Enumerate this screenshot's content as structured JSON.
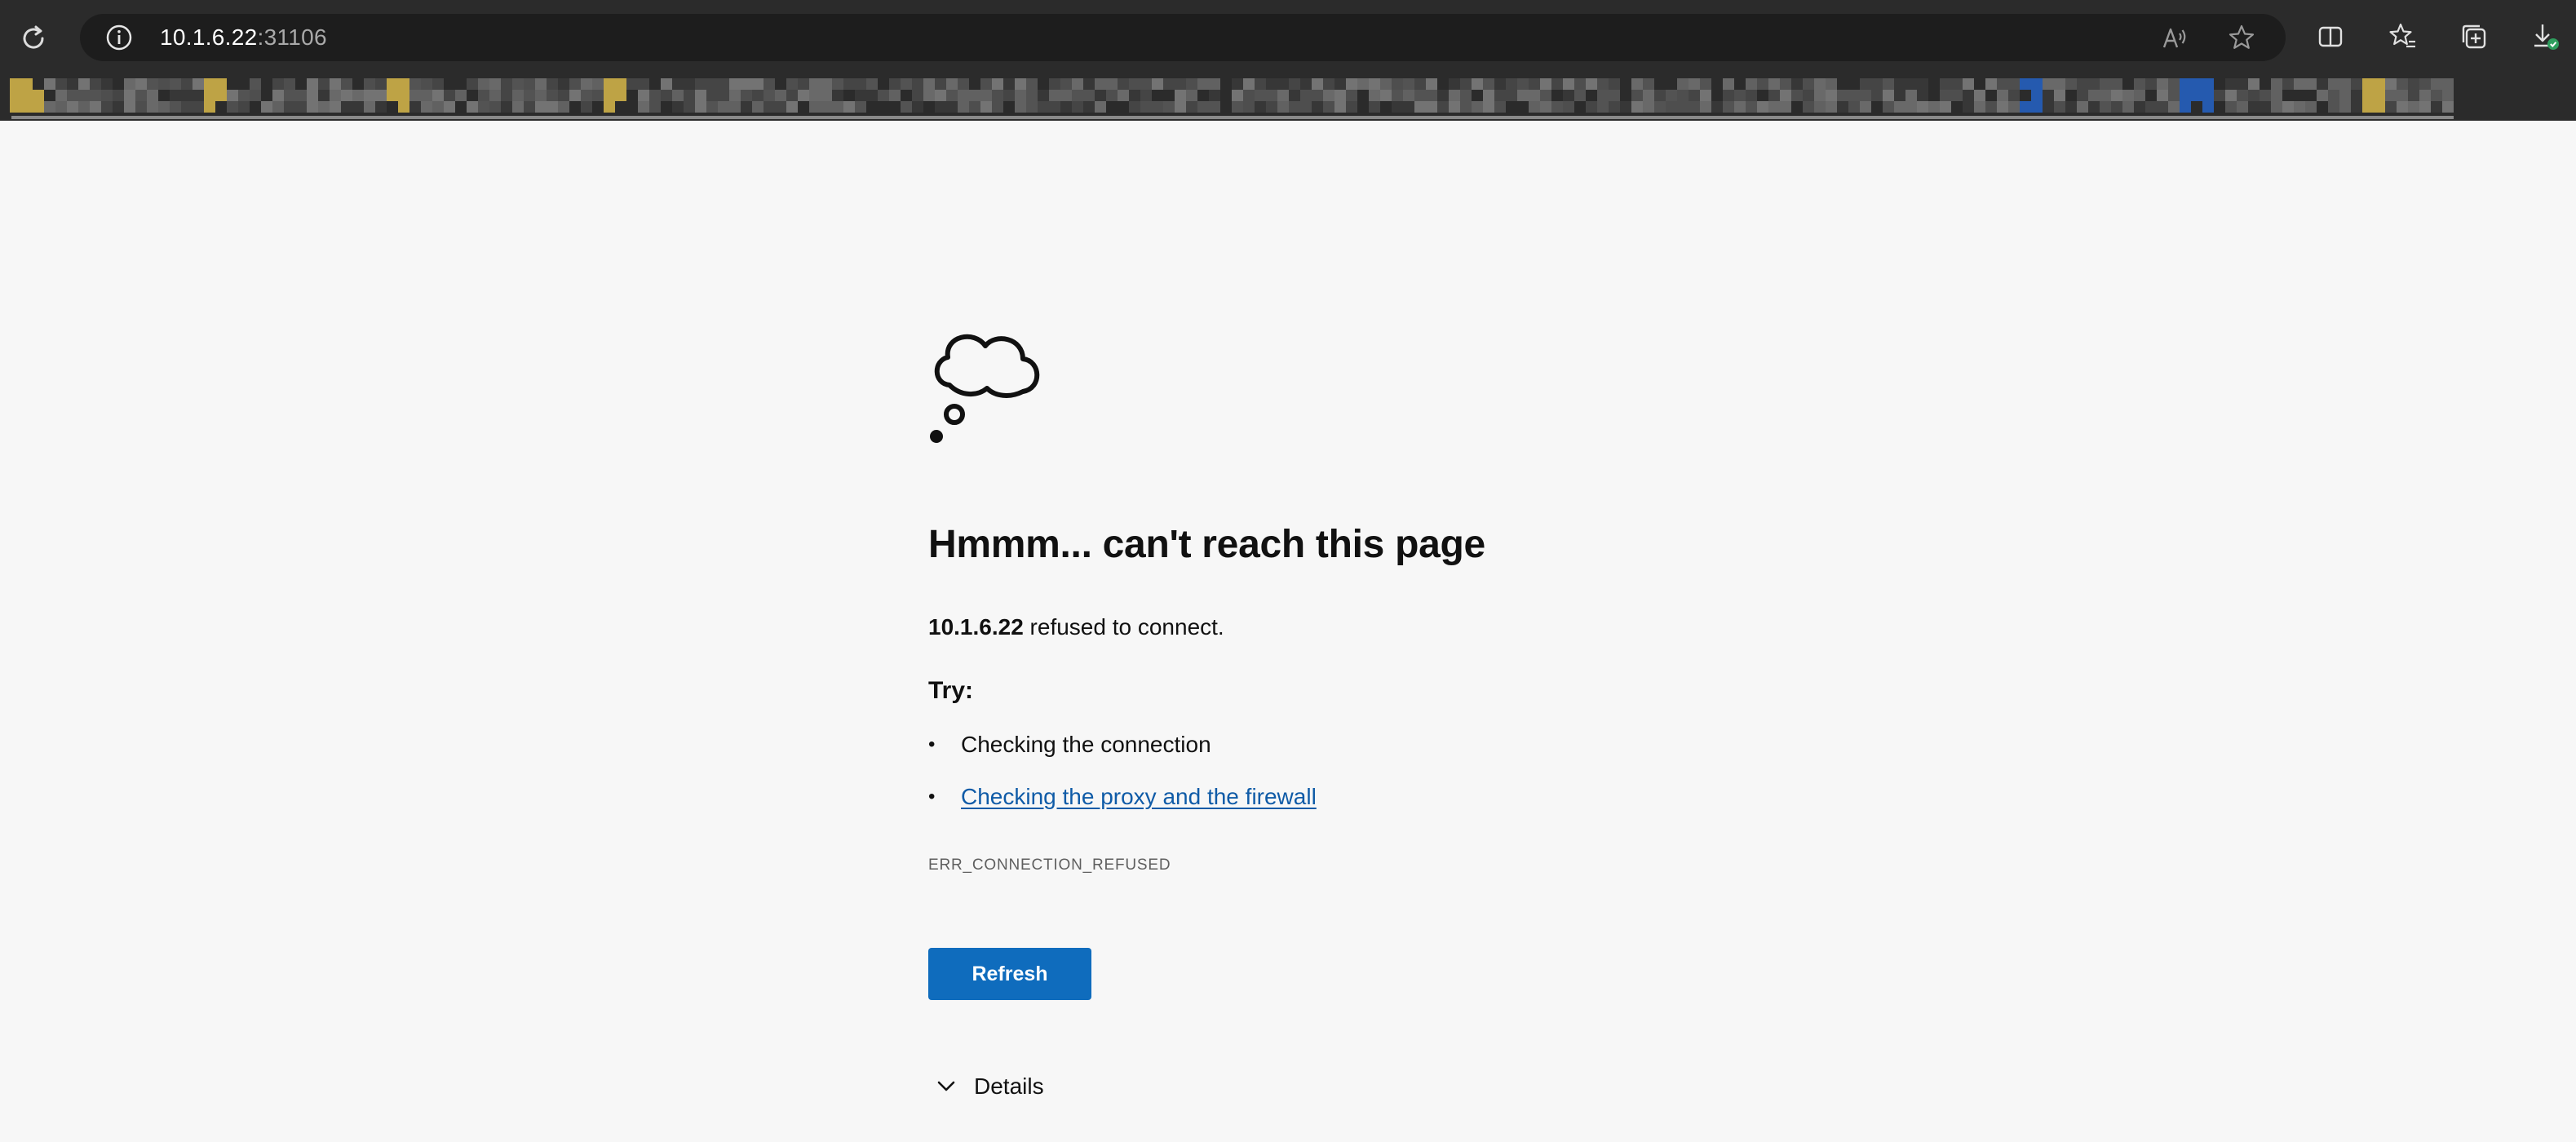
{
  "browser": {
    "url_host": "10.1.6.22",
    "url_port": ":31106",
    "icons": {
      "reload": "reload-icon",
      "site_info": "info-icon",
      "read_aloud": "read-aloud-icon",
      "favorite": "star-icon",
      "split_screen": "split-screen-icon",
      "favorites": "favorites-icon",
      "collections": "collections-icon",
      "downloads": "download-icon"
    }
  },
  "page": {
    "heading": "Hmmm... can't reach this page",
    "message_host": "10.1.6.22",
    "message_rest": " refused to connect.",
    "try_label": "Try:",
    "suggestions": [
      "Checking the connection",
      "Checking the proxy and the firewall"
    ],
    "error_code": "ERR_CONNECTION_REFUSED",
    "refresh_label": "Refresh",
    "details_label": "Details",
    "accent_color": "#0f6cbd",
    "link_color": "#0f5ba7"
  }
}
